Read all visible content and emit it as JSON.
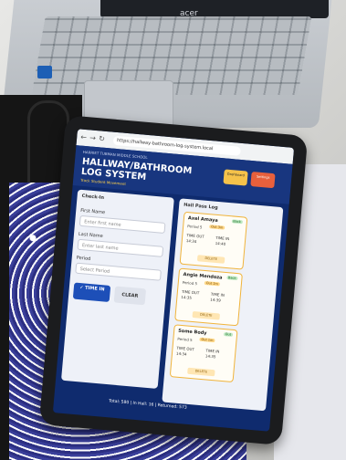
{
  "laptop": {
    "brand": "acer"
  },
  "browser": {
    "url": "https://hallway-bathroom-log-system.local"
  },
  "app": {
    "school": "HARRIET TUBMAN MIDDLE SCHOOL",
    "title_line1": "HALLWAY/BATHROOM",
    "title_line2": "LOG SYSTEM",
    "subtitle": "Track Student Movement",
    "header_buttons": [
      "Dashboard",
      "Settings"
    ]
  },
  "checkin": {
    "heading": "Check-In",
    "first_name_label": "First Name",
    "first_name_placeholder": "Enter first name",
    "last_name_label": "Last Name",
    "last_name_placeholder": "Enter last name",
    "period_label": "Period",
    "period_value": "Select Period",
    "time_in_label": "✓ TIME IN",
    "clear_label": "CLEAR"
  },
  "log": {
    "heading": "Hall Pass Log",
    "entries": [
      {
        "name": "Axel Amaya",
        "period": "Period 5",
        "tag": "Out 3m",
        "badge": "Back",
        "time_out_label": "TIME OUT",
        "time_out": "14:34",
        "time_in_label": "TIME IN",
        "time_in": "14:40",
        "delete": "DELETE"
      },
      {
        "name": "Angie Mendoza",
        "period": "Period 5",
        "tag": "Out 2m",
        "badge": "Back",
        "time_out_label": "TIME OUT",
        "time_out": "14:35",
        "time_in_label": "TIME IN",
        "time_in": "14:39",
        "delete": "DELETE"
      },
      {
        "name": "Some Body",
        "period": "Period 5",
        "tag": "Out 1m",
        "badge": "Out",
        "time_out_label": "TIME OUT",
        "time_out": "14:34",
        "time_in_label": "TIME IN",
        "time_in": "14:35",
        "delete": "DELETE"
      }
    ],
    "footer": "Total: 580 | In Hall: 16 | Returned: 573"
  },
  "icons": [
    "back-icon",
    "forward-icon",
    "refresh-icon",
    "check-icon",
    "clipboard-icon"
  ],
  "colors": {
    "header": "#18367f",
    "accent": "#1d4fb8",
    "warn": "#f0b43c"
  }
}
